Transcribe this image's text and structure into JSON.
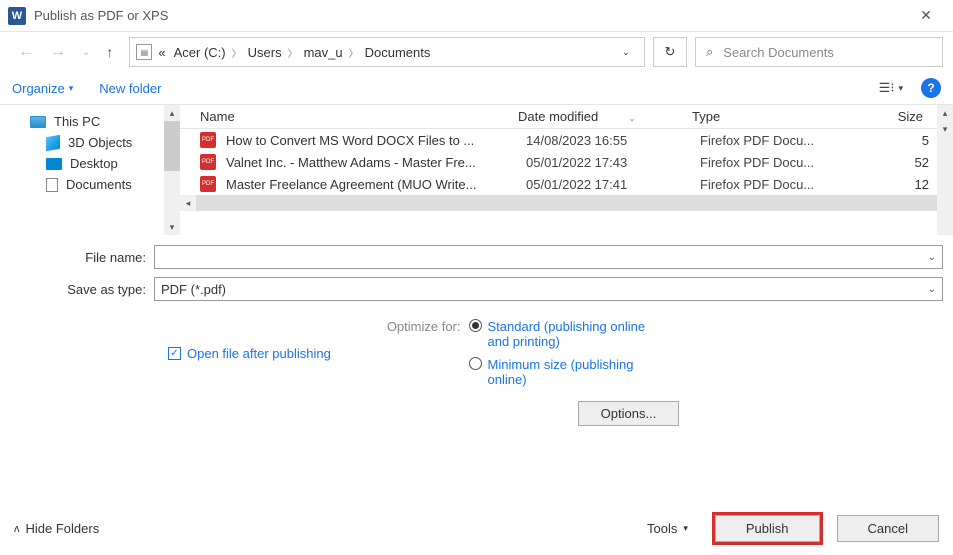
{
  "window": {
    "title": "Publish as PDF or XPS"
  },
  "breadcrumb": {
    "root": "«",
    "seg1": "Acer (C:)",
    "seg2": "Users",
    "seg3": "mav_u",
    "seg4": "Documents"
  },
  "search": {
    "placeholder": "Search Documents"
  },
  "toolbar": {
    "organize": "Organize",
    "new_folder": "New folder"
  },
  "sidebar": {
    "items": [
      {
        "label": "This PC"
      },
      {
        "label": "3D Objects"
      },
      {
        "label": "Desktop"
      },
      {
        "label": "Documents"
      }
    ]
  },
  "columns": {
    "name": "Name",
    "date": "Date modified",
    "type": "Type",
    "size": "Size"
  },
  "files": [
    {
      "name": "How to Convert MS Word DOCX Files to ...",
      "date": "14/08/2023 16:55",
      "type": "Firefox PDF Docu...",
      "size": "5"
    },
    {
      "name": "Valnet Inc. - Matthew Adams - Master Fre...",
      "date": "05/01/2022 17:43",
      "type": "Firefox PDF Docu...",
      "size": "52"
    },
    {
      "name": "Master Freelance Agreement (MUO Write...",
      "date": "05/01/2022 17:41",
      "type": "Firefox PDF Docu...",
      "size": "12"
    }
  ],
  "form": {
    "file_name_label": "File name:",
    "file_name_value": "",
    "save_type_label": "Save as type:",
    "save_type_value": "PDF (*.pdf)"
  },
  "options": {
    "open_after": "Open file after publishing",
    "optimize_label": "Optimize for:",
    "standard": "Standard (publishing online and printing)",
    "minimum": "Minimum size (publishing online)",
    "options_btn": "Options..."
  },
  "footer": {
    "hide_folders": "Hide Folders",
    "tools": "Tools",
    "publish": "Publish",
    "cancel": "Cancel"
  }
}
